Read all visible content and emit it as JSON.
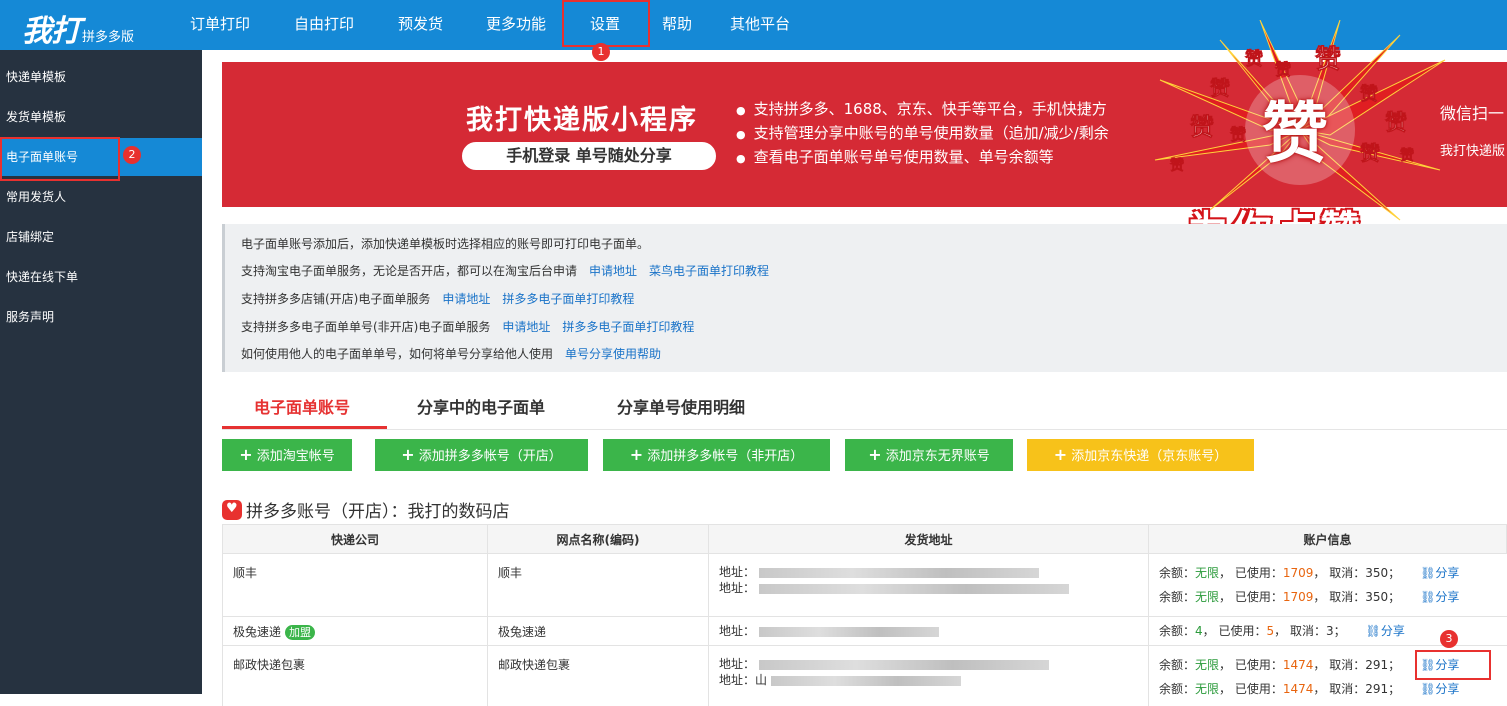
{
  "logo": {
    "main": "我打",
    "sub": "拼多多版"
  },
  "nav": [
    {
      "label": "订单打印"
    },
    {
      "label": "自由打印"
    },
    {
      "label": "预发货"
    },
    {
      "label": "更多功能"
    },
    {
      "label": "设置"
    },
    {
      "label": "帮助"
    },
    {
      "label": "其他平台"
    }
  ],
  "badges": [
    "1",
    "2",
    "3"
  ],
  "sidebar": [
    {
      "label": "快递单模板"
    },
    {
      "label": "发货单模板"
    },
    {
      "label": "电子面单账号"
    },
    {
      "label": "常用发货人"
    },
    {
      "label": "店铺绑定"
    },
    {
      "label": "快递在线下单"
    },
    {
      "label": "服务声明"
    }
  ],
  "banner": {
    "title": "我打快递版小程序",
    "subtitle": "手机登录  单号随处分享",
    "points": [
      "支持拼多多、1688、京东、快手等平台，手机快捷方",
      "支持管理分享中账号的单号使用数量（追加/减少/剩余",
      "查看电子面单账号单号使用数量、单号余额等"
    ],
    "right1": "微信扫一",
    "right2": "我打快递版",
    "like_char": "赞",
    "like_text": "为你点赞"
  },
  "info": {
    "line1": "电子面单账号添加后，添加快递单模板时选择相应的账号即可打印电子面单。",
    "line2": "支持淘宝电子面单服务，无论是否开店，都可以在淘宝后台申请",
    "line2_links": [
      "申请地址",
      "菜鸟电子面单打印教程"
    ],
    "line3": "支持拼多多店铺(开店)电子面单服务",
    "line3_links": [
      "申请地址",
      "拼多多电子面单打印教程"
    ],
    "line4": "支持拼多多电子面单单号(非开店)电子面单服务",
    "line4_links": [
      "申请地址",
      "拼多多电子面单打印教程"
    ],
    "line5": "如何使用他人的电子面单单号，如何将单号分享给他人使用",
    "line5_links": [
      "单号分享使用帮助"
    ]
  },
  "tabs": [
    {
      "label": "电子面单账号"
    },
    {
      "label": "分享中的电子面单"
    },
    {
      "label": "分享单号使用明细"
    }
  ],
  "add_buttons": [
    {
      "label": "添加淘宝帐号"
    },
    {
      "label": "添加拼多多帐号（开店）"
    },
    {
      "label": "添加拼多多帐号（非开店）"
    },
    {
      "label": "添加京东无界账号"
    },
    {
      "label": "添加京东快递（京东账号）"
    }
  ],
  "account": {
    "title": "拼多多账号（开店）：我打的数码店"
  },
  "table": {
    "headers": [
      "快递公司",
      "网点名称(编码)",
      "发货地址",
      "账户信息"
    ],
    "address_label": "地址：",
    "address_label_partial": "地址：山",
    "balance_label": "余额：",
    "used_label": "已使用：",
    "cancel_label": "取消：",
    "share_label": "分享",
    "jiameng": "加盟",
    "rows": [
      {
        "company": "顺丰",
        "site": "顺丰",
        "accounts": [
          {
            "balance": "无限",
            "used": "1709",
            "cancel": "350"
          },
          {
            "balance": "无限",
            "used": "1709",
            "cancel": "350"
          }
        ]
      },
      {
        "company": "极兔速递",
        "site": "极兔速递",
        "accounts": [
          {
            "balance": "4",
            "used": "5",
            "cancel": "3"
          }
        ]
      },
      {
        "company": "邮政快递包裹",
        "site": "邮政快递包裹",
        "accounts": [
          {
            "balance": "无限",
            "used": "1474",
            "cancel": "291"
          },
          {
            "balance": "无限",
            "used": "1474",
            "cancel": "291"
          }
        ]
      }
    ]
  },
  "colors": {
    "nav": "#1589d6",
    "sidebar": "#263240",
    "banner": "#d52a35",
    "green": "#3bb54a",
    "yellow": "#f7c21a",
    "highlight": "#e8312f"
  }
}
